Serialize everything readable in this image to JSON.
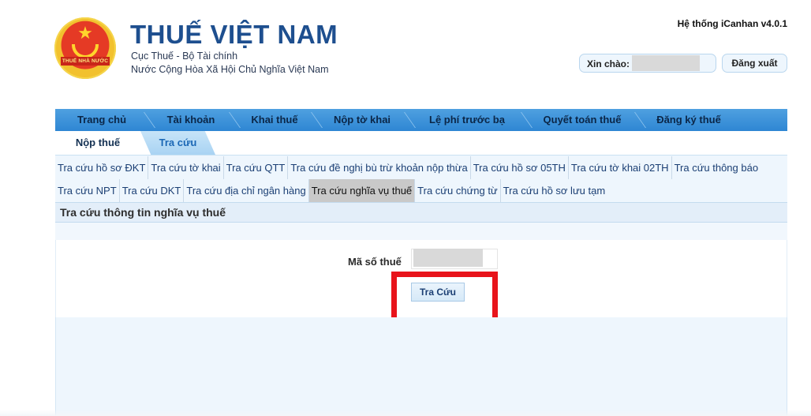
{
  "header": {
    "logo_text": "THUẾ NHÀ NƯỚC",
    "title": "THUẾ VIỆT NAM",
    "subtitle_1": "Cục Thuế - Bộ Tài chính",
    "subtitle_2": "Nước Cộng Hòa Xã Hội Chủ Nghĩa Việt Nam",
    "system_version": "Hệ thống iCanhan v4.0.1",
    "greeting_label": "Xin chào:",
    "logout_label": "Đăng xuất"
  },
  "main_nav": [
    {
      "label": "Trang chủ"
    },
    {
      "label": "Tài khoản"
    },
    {
      "label": "Khai thuế"
    },
    {
      "label": "Nộp tờ khai"
    },
    {
      "label": "Lệ phí trước bạ"
    },
    {
      "label": "Quyết toán thuế"
    },
    {
      "label": "Đăng ký thuế"
    }
  ],
  "sub_tabs": {
    "tab_1": "Nộp thuế",
    "tab_2": "Tra cứu"
  },
  "links": {
    "row_1": [
      "Tra cứu hồ sơ ĐKT",
      "Tra cứu tờ khai",
      "Tra cứu QTT",
      "Tra cứu đề nghị bù trừ khoản nộp thừa",
      "Tra cứu hồ sơ 05TH",
      "Tra cứu tờ khai 02TH",
      "Tra cứu thông báo"
    ],
    "row_2": [
      "Tra cứu NPT",
      "Tra cứu DKT",
      "Tra cứu địa chỉ ngân hàng",
      "Tra cứu nghĩa vụ thuế",
      "Tra cứu chứng từ",
      "Tra cứu hồ sơ lưu tạm"
    ],
    "active": "Tra cứu nghĩa vụ thuế"
  },
  "section": {
    "title": "Tra cứu thông tin nghĩa vụ thuế"
  },
  "form": {
    "tax_code_label": "Mã số thuế",
    "tax_code_value": "",
    "search_button": "Tra Cứu"
  },
  "colors": {
    "brand_blue": "#1e4f8f",
    "nav_blue": "#2e86d3",
    "highlight_red": "#e8141b"
  }
}
